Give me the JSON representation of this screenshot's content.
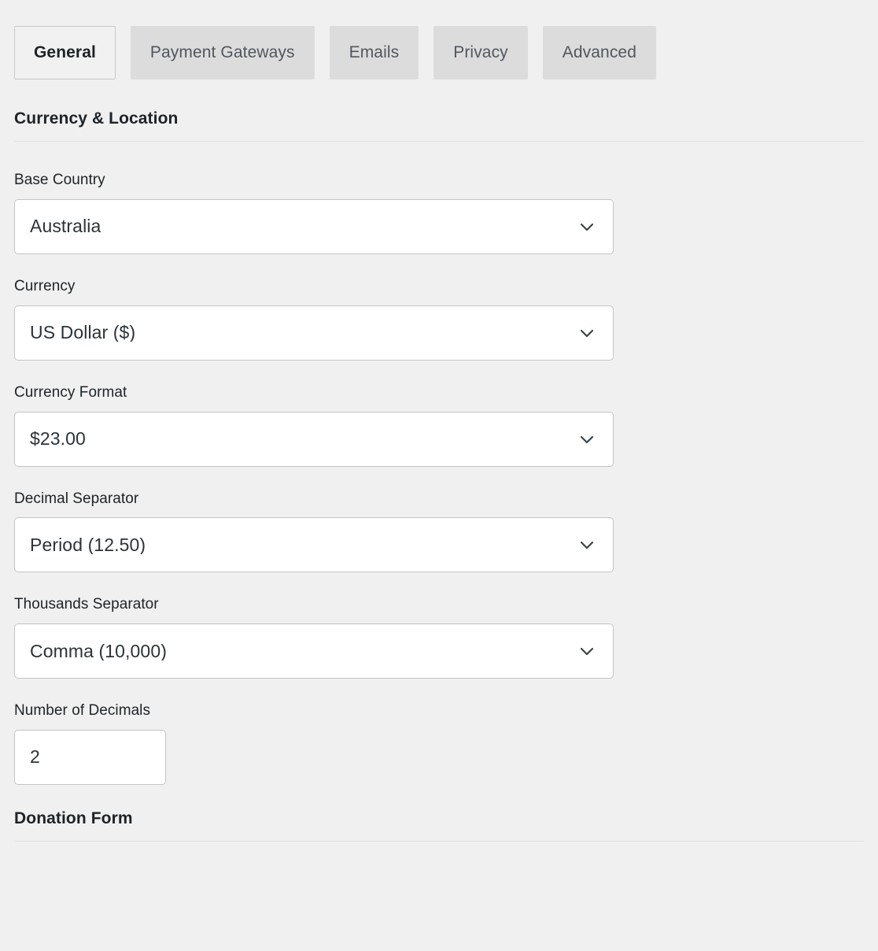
{
  "tabs": [
    {
      "label": "General",
      "active": true
    },
    {
      "label": "Payment Gateways",
      "active": false
    },
    {
      "label": "Emails",
      "active": false
    },
    {
      "label": "Privacy",
      "active": false
    },
    {
      "label": "Advanced",
      "active": false
    }
  ],
  "sections": {
    "currency_location": {
      "heading": "Currency & Location",
      "fields": [
        {
          "label": "Base Country",
          "value": "Australia",
          "type": "select",
          "icon": "chevron-down-icon"
        },
        {
          "label": "Currency",
          "value": "US Dollar ($)",
          "type": "select",
          "icon": "chevron-down-icon"
        },
        {
          "label": "Currency Format",
          "value": "$23.00",
          "type": "select",
          "icon": "chevron-down-icon"
        },
        {
          "label": "Decimal Separator",
          "value": "Period (12.50)",
          "type": "select",
          "icon": "chevron-down-icon"
        },
        {
          "label": "Thousands Separator",
          "value": "Comma (10,000)",
          "type": "select",
          "icon": "chevron-down-icon"
        },
        {
          "label": "Number of Decimals",
          "value": "2",
          "type": "number",
          "icon": ""
        }
      ]
    },
    "donation_form": {
      "heading": "Donation Form"
    }
  },
  "colors": {
    "page_background": "#f0f0f0",
    "tab_inactive": "#dcdcdc",
    "tab_active": "#f1f1f1",
    "input_background": "#ffffff",
    "input_border": "#c3c4c7",
    "divider": "#e2e2e2",
    "text_primary": "#1d2327",
    "text_secondary": "#50575e"
  }
}
